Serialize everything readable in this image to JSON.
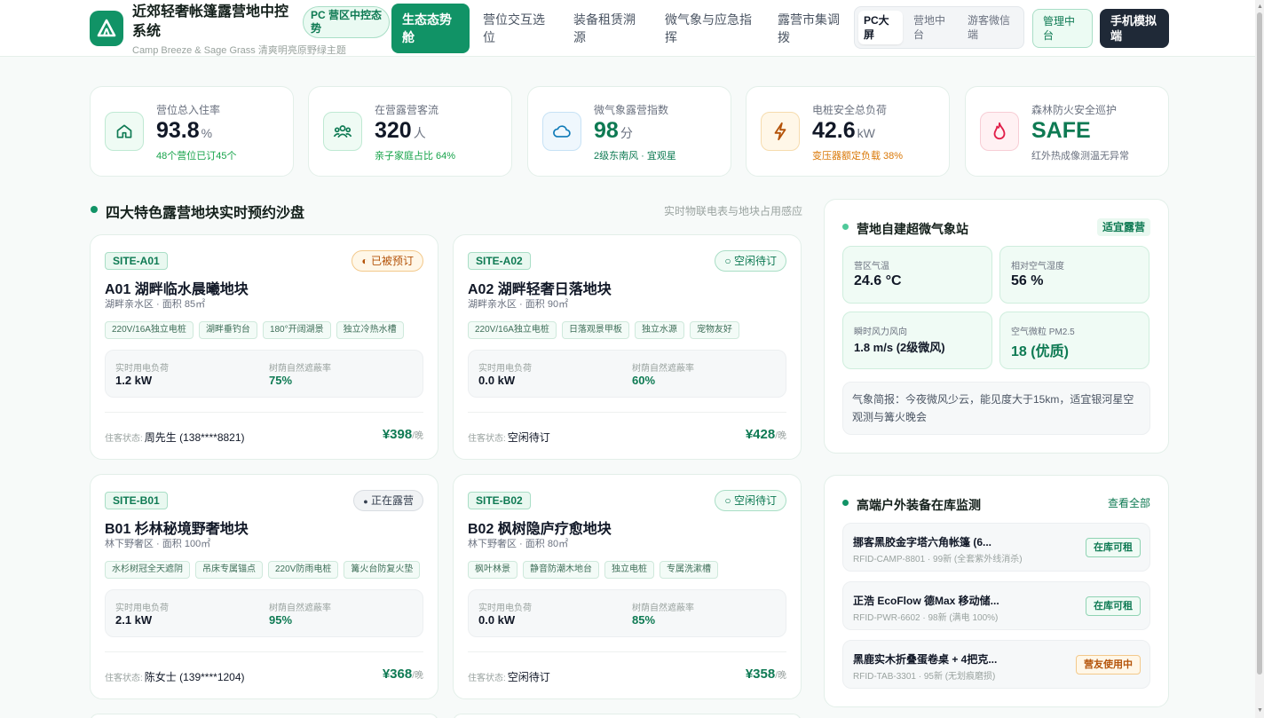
{
  "header": {
    "title": "近郊轻奢帐篷露营地中控系统",
    "subtitle": "Camp Breeze & Sage Grass 清爽明亮原野绿主题",
    "badge": "PC 营区中控态势",
    "nav": [
      "生态态势舱",
      "营位交互选位",
      "装备租赁溯源",
      "微气象与应急指挥",
      "露营市集调拨"
    ],
    "active_nav": 0,
    "view_modes": [
      "PC大屏",
      "营地中台",
      "游客微信端"
    ],
    "active_view": 0,
    "admin_button": "管理中台",
    "mobile_button": "手机模拟端"
  },
  "kpis": [
    {
      "label": "营位总入住率",
      "value": "93.8",
      "unit": "%",
      "sub": "48个营位已订45个",
      "icon": "home-icon",
      "color": "#16a34a"
    },
    {
      "label": "在营露营客流",
      "value": "320",
      "unit": "人",
      "sub": "亲子家庭占比 64%",
      "icon": "users-icon",
      "color": "#0e7a53"
    },
    {
      "label": "微气象露营指数",
      "value": "98",
      "unit": "分",
      "sub": "2级东南风 · 宜观星",
      "icon": "cloud-icon",
      "color": "#0e7a53"
    },
    {
      "label": "电桩安全总负荷",
      "value": "42.6",
      "unit": "kW",
      "sub": "变压器额定负载 38%",
      "icon": "lightning-icon",
      "color": "#d97706"
    },
    {
      "label": "森林防火安全巡护",
      "value": "SAFE",
      "unit": "",
      "sub": "红外热成像测温无异常",
      "icon": "flame-icon",
      "color": "#e11d48"
    }
  ],
  "sites_section": {
    "title": "四大特色露营地块实时预约沙盘",
    "right": "实时物联电表与地块占用感应"
  },
  "site_labels": {
    "power": "实时用电负荷",
    "shade": "树荫自然遮蔽率",
    "guest": "住客状态:",
    "price_unit": "/晚"
  },
  "sites": [
    {
      "code": "SITE-A01",
      "status": "已被预订",
      "status_type": "booked",
      "status_icon": "◐",
      "name": "A01 湖畔临水晨曦地块",
      "meta": "湖畔亲水区 · 面积 85㎡",
      "tags": [
        "220V/16A独立电桩",
        "湖畔垂钓台",
        "180°开阔湖景",
        "独立冷热水槽"
      ],
      "power": "1.2 kW",
      "shade": "75%",
      "guest": "周先生 (138****8821)",
      "price": "¥398"
    },
    {
      "code": "SITE-A02",
      "status": "空闲待订",
      "status_type": "free",
      "status_icon": "○",
      "name": "A02 湖畔轻奢日落地块",
      "meta": "湖畔亲水区 · 面积 90㎡",
      "tags": [
        "220V/16A独立电桩",
        "日落观景甲板",
        "独立水源",
        "宠物友好"
      ],
      "power": "0.0 kW",
      "shade": "60%",
      "guest": "空闲待订",
      "price": "¥428"
    },
    {
      "code": "SITE-B01",
      "status": "正在露营",
      "status_type": "camp",
      "status_icon": "●",
      "name": "B01 杉林秘境野奢地块",
      "meta": "林下野奢区 · 面积 100㎡",
      "tags": [
        "水杉树冠全天遮阴",
        "吊床专属锚点",
        "220V防雨电桩",
        "篝火台防复火垫"
      ],
      "power": "2.1 kW",
      "shade": "95%",
      "guest": "陈女士 (139****1204)",
      "price": "¥368"
    },
    {
      "code": "SITE-B02",
      "status": "空闲待订",
      "status_type": "free",
      "status_icon": "○",
      "name": "B02 枫树隐庐疗愈地块",
      "meta": "林下野奢区 · 面积 80㎡",
      "tags": [
        "枫叶林景",
        "静音防潮木地台",
        "独立电桩",
        "专属洗漱槽"
      ],
      "power": "0.0 kW",
      "shade": "85%",
      "guest": "空闲待订",
      "price": "¥358"
    }
  ],
  "weather": {
    "title": "营地自建超微气象站",
    "badge": "适宜露营",
    "items": [
      {
        "label": "营区气温",
        "value": "24.6 °C"
      },
      {
        "label": "相对空气湿度",
        "value": "56 %"
      },
      {
        "label": "瞬时风力风向",
        "value": "1.8 m/s (2级微风)"
      },
      {
        "label": "空气微粒 PM2.5",
        "value": "18 (优质)"
      }
    ],
    "brief": "气象简报：今夜微风少云，能见度大于15km，适宜银河星空观测与篝火晚会"
  },
  "gear": {
    "title": "高端户外装备在库监测",
    "link": "查看全部",
    "items": [
      {
        "name": "挪客黑胶金字塔六角帐篷 (6...",
        "meta": "RFID-CAMP-8801 · 99新 (全套紫外线消杀)",
        "status": "在库可租",
        "type": "in"
      },
      {
        "name": "正浩 EcoFlow 德Max 移动储...",
        "meta": "RFID-PWR-6602 · 98新 (满电 100%)",
        "status": "在库可租",
        "type": "in"
      },
      {
        "name": "黑鹿实木折叠蛋卷桌 + 4把克...",
        "meta": "RFID-TAB-3301 · 95新 (无划痕磨损)",
        "status": "营友使用中",
        "type": "use"
      }
    ]
  }
}
